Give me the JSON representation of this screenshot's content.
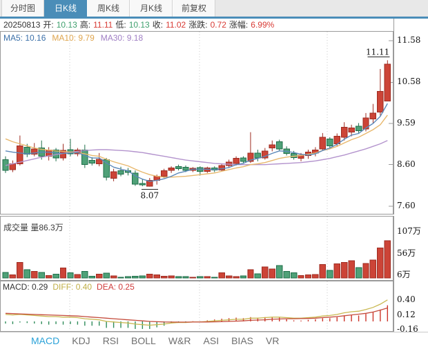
{
  "top_tabs": {
    "items": [
      "分时图",
      "日K线",
      "周K线",
      "月K线",
      "前复权"
    ],
    "active": "日K线"
  },
  "info_bar": {
    "date": "20250813",
    "open_label": "开:",
    "open": "10.13",
    "high_label": "高:",
    "high": "11.11",
    "low_label": "低:",
    "low": "10.13",
    "close_label": "收:",
    "close": "11.02",
    "change_label": "涨跌:",
    "change": "0.72",
    "pct_label": "涨幅:",
    "pct": "6.99%"
  },
  "ma_labels": {
    "ma5": "MA5: 10.16",
    "ma10": "MA10: 9.79",
    "ma30": "MA30: 9.18"
  },
  "volume_label": "成交量 量86.3万",
  "macd_labels": {
    "macd": "MACD: 0.29",
    "diff": "DIFF: 0.40",
    "dea": "DEA: 0.25"
  },
  "bottom_tabs": {
    "items": [
      "MACD",
      "KDJ",
      "RSI",
      "BOLL",
      "W&R",
      "ASI",
      "BIAS",
      "VR"
    ],
    "active": "MACD"
  },
  "colors": {
    "accent_blue": "#4a8db8",
    "tab_active_text": "#2aa2d8",
    "text_red": "#d83a34",
    "text_green": "#3fa06e",
    "up_fill": "#cc4437",
    "up_stroke": "#9e2b20",
    "down_fill": "#4fa178",
    "down_stroke": "#1e6e49",
    "ma5": "#5b87b8",
    "ma10": "#e8b86d",
    "ma30": "#b393cd",
    "diff_line": "#c9b850",
    "dea_line": "#c44a3a",
    "hist_red": "#cc3328",
    "hist_green": "#2f8c5a"
  },
  "chart_data": [
    {
      "type": "candlestick",
      "title": "日K线",
      "ylim": [
        7.6,
        11.58
      ],
      "yticks": [
        {
          "label": "11.58",
          "value": 11.58
        },
        {
          "label": "10.58",
          "value": 10.58
        },
        {
          "label": "9.59",
          "value": 9.59
        },
        {
          "label": "8.60",
          "value": 8.6
        },
        {
          "label": "7.60",
          "value": 7.6
        }
      ],
      "candles": [
        [
          8.72,
          8.8,
          8.4,
          8.46
        ],
        [
          8.48,
          8.7,
          8.42,
          8.62
        ],
        [
          8.62,
          9.3,
          8.58,
          9.05
        ],
        [
          9.02,
          9.1,
          8.78,
          8.85
        ],
        [
          8.85,
          9.12,
          8.8,
          8.98
        ],
        [
          9.0,
          9.18,
          8.72,
          8.8
        ],
        [
          8.8,
          9.02,
          8.7,
          8.95
        ],
        [
          8.95,
          9.0,
          8.68,
          8.76
        ],
        [
          8.76,
          9.1,
          8.7,
          8.94
        ],
        [
          8.96,
          9.22,
          8.8,
          8.86
        ],
        [
          8.86,
          9.0,
          8.8,
          8.95
        ],
        [
          8.95,
          9.08,
          8.52,
          8.6
        ],
        [
          8.7,
          8.78,
          8.58,
          8.64
        ],
        [
          8.62,
          8.88,
          8.56,
          8.73
        ],
        [
          8.72,
          8.76,
          8.22,
          8.3
        ],
        [
          8.27,
          8.5,
          8.2,
          8.43
        ],
        [
          8.45,
          8.55,
          8.32,
          8.37
        ],
        [
          8.45,
          8.52,
          8.34,
          8.41
        ],
        [
          8.4,
          8.46,
          8.09,
          8.13
        ],
        [
          8.15,
          8.26,
          8.08,
          8.11
        ],
        [
          8.08,
          8.28,
          8.07,
          8.22
        ],
        [
          8.22,
          8.36,
          8.12,
          8.32
        ],
        [
          8.32,
          8.5,
          8.28,
          8.45
        ],
        [
          8.46,
          8.56,
          8.4,
          8.52
        ],
        [
          8.55,
          8.6,
          8.46,
          8.5
        ],
        [
          8.54,
          8.58,
          8.42,
          8.46
        ],
        [
          8.46,
          8.54,
          8.42,
          8.51
        ],
        [
          8.53,
          8.56,
          8.34,
          8.44
        ],
        [
          8.44,
          8.55,
          8.4,
          8.52
        ],
        [
          8.52,
          8.56,
          8.42,
          8.47
        ],
        [
          8.47,
          8.62,
          8.44,
          8.58
        ],
        [
          8.58,
          8.72,
          8.52,
          8.66
        ],
        [
          8.63,
          8.8,
          8.58,
          8.75
        ],
        [
          8.76,
          8.8,
          8.62,
          8.68
        ],
        [
          8.68,
          9.38,
          8.64,
          8.88
        ],
        [
          8.88,
          8.96,
          8.68,
          8.76
        ],
        [
          8.76,
          9.0,
          8.72,
          8.93
        ],
        [
          9.0,
          9.18,
          8.92,
          9.08
        ],
        [
          9.15,
          9.2,
          8.94,
          8.98
        ],
        [
          8.98,
          9.04,
          8.82,
          8.87
        ],
        [
          8.87,
          8.93,
          8.72,
          8.77
        ],
        [
          8.75,
          8.88,
          8.68,
          8.83
        ],
        [
          8.82,
          8.96,
          8.74,
          8.9
        ],
        [
          8.88,
          9.02,
          8.8,
          8.95
        ],
        [
          8.98,
          9.36,
          8.94,
          9.26
        ],
        [
          9.22,
          9.26,
          8.98,
          9.05
        ],
        [
          9.1,
          9.35,
          9.05,
          9.28
        ],
        [
          9.26,
          9.62,
          9.18,
          9.5
        ],
        [
          9.38,
          9.56,
          9.28,
          9.48
        ],
        [
          9.52,
          9.6,
          9.36,
          9.42
        ],
        [
          9.46,
          9.84,
          9.4,
          9.72
        ],
        [
          9.7,
          10.06,
          9.6,
          9.84
        ],
        [
          9.86,
          10.9,
          9.78,
          10.36
        ],
        [
          10.13,
          11.11,
          10.13,
          11.02
        ]
      ],
      "ma5": [
        8.93,
        8.9,
        8.88,
        8.86,
        8.88,
        8.9,
        8.9,
        8.88,
        8.87,
        8.88,
        8.89,
        8.82,
        8.76,
        8.76,
        8.64,
        8.54,
        8.49,
        8.45,
        8.33,
        8.25,
        8.2,
        8.22,
        8.26,
        8.32,
        8.4,
        8.44,
        8.49,
        8.49,
        8.49,
        8.48,
        8.5,
        8.53,
        8.6,
        8.63,
        8.71,
        8.75,
        8.8,
        8.87,
        8.93,
        8.92,
        8.89,
        8.85,
        8.83,
        8.86,
        8.94,
        9.0,
        9.09,
        9.21,
        9.31,
        9.35,
        9.48,
        9.59,
        9.76,
        10.07
      ],
      "ma10": [
        9.22,
        9.15,
        9.1,
        9.05,
        9.0,
        8.97,
        8.95,
        8.93,
        8.92,
        8.9,
        8.89,
        8.86,
        8.82,
        8.8,
        8.73,
        8.67,
        8.62,
        8.57,
        8.49,
        8.42,
        8.36,
        8.32,
        8.3,
        8.3,
        8.31,
        8.32,
        8.34,
        8.36,
        8.38,
        8.4,
        8.44,
        8.48,
        8.52,
        8.55,
        8.6,
        8.62,
        8.65,
        8.7,
        8.75,
        8.78,
        8.8,
        8.82,
        8.85,
        8.88,
        8.94,
        8.98,
        9.04,
        9.12,
        9.2,
        9.26,
        9.35,
        9.44,
        9.56,
        9.79
      ],
      "ma30": [
        8.58,
        8.62,
        8.66,
        8.7,
        8.74,
        8.78,
        8.81,
        8.84,
        8.87,
        8.9,
        8.92,
        8.94,
        8.95,
        8.96,
        8.96,
        8.95,
        8.94,
        8.93,
        8.91,
        8.89,
        8.86,
        8.83,
        8.8,
        8.77,
        8.74,
        8.71,
        8.69,
        8.67,
        8.65,
        8.63,
        8.62,
        8.61,
        8.6,
        8.6,
        8.6,
        8.6,
        8.6,
        8.61,
        8.62,
        8.63,
        8.64,
        8.65,
        8.67,
        8.69,
        8.72,
        8.75,
        8.79,
        8.83,
        8.88,
        8.93,
        8.98,
        9.04,
        9.1,
        9.18
      ],
      "annotations": {
        "high_label": "11.11",
        "high_index": 53,
        "low_label": "8.07",
        "low_index": 20
      }
    },
    {
      "type": "bar",
      "title": "成交量",
      "unit": "万",
      "current": 86.3,
      "yticks": [
        {
          "label": "107万",
          "value": 107
        },
        {
          "label": "56万",
          "value": 56
        },
        {
          "label": "6万",
          "value": 6
        }
      ],
      "values": [
        13,
        7,
        36,
        19,
        15,
        13,
        6,
        9,
        23,
        12,
        8,
        15,
        4,
        9,
        11,
        5,
        2,
        3,
        4,
        5,
        9,
        7,
        4,
        5,
        3,
        3,
        2,
        3,
        3,
        2,
        12,
        5,
        3,
        5,
        19,
        10,
        26,
        21,
        29,
        15,
        12,
        6,
        7,
        8,
        31,
        18,
        33,
        36,
        40,
        24,
        34,
        42,
        70,
        86.3
      ]
    },
    {
      "type": "macd",
      "macd_last": 0.29,
      "diff_last": 0.4,
      "dea_last": 0.25,
      "yticks": [
        {
          "label": "0.40",
          "value": 0.4
        },
        {
          "label": "0.12",
          "value": 0.12
        },
        {
          "label": "-0.16",
          "value": -0.16
        }
      ],
      "diff": [
        0.13,
        0.12,
        0.13,
        0.12,
        0.11,
        0.1,
        0.09,
        0.09,
        0.08,
        0.08,
        0.07,
        0.05,
        0.04,
        0.03,
        0.0,
        -0.01,
        -0.02,
        -0.03,
        -0.05,
        -0.06,
        -0.07,
        -0.06,
        -0.05,
        -0.03,
        -0.02,
        -0.02,
        -0.01,
        -0.01,
        0.0,
        0.01,
        0.02,
        0.03,
        0.04,
        0.04,
        0.06,
        0.06,
        0.07,
        0.08,
        0.08,
        0.07,
        0.06,
        0.06,
        0.07,
        0.08,
        0.1,
        0.11,
        0.13,
        0.16,
        0.18,
        0.19,
        0.22,
        0.26,
        0.32,
        0.4
      ],
      "dea": [
        0.15,
        0.145,
        0.14,
        0.135,
        0.13,
        0.125,
        0.12,
        0.115,
        0.11,
        0.105,
        0.1,
        0.09,
        0.08,
        0.07,
        0.06,
        0.05,
        0.04,
        0.03,
        0.02,
        0.01,
        0.0,
        -0.005,
        -0.01,
        -0.012,
        -0.013,
        -0.013,
        -0.012,
        -0.011,
        -0.01,
        -0.008,
        -0.005,
        0.0,
        0.005,
        0.01,
        0.02,
        0.025,
        0.03,
        0.04,
        0.045,
        0.05,
        0.05,
        0.052,
        0.055,
        0.06,
        0.07,
        0.08,
        0.09,
        0.105,
        0.12,
        0.135,
        0.15,
        0.175,
        0.21,
        0.25
      ]
    }
  ]
}
